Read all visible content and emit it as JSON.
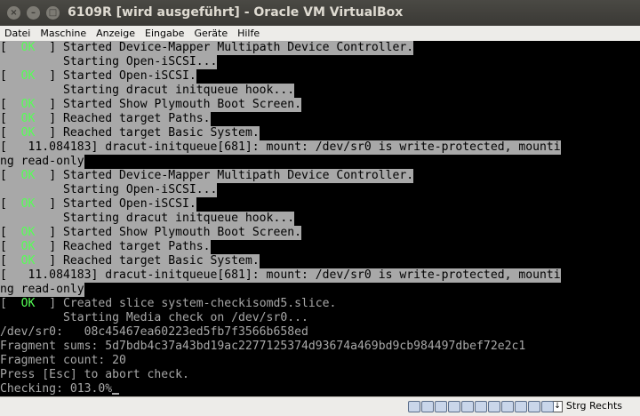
{
  "window": {
    "title": "6109R [wird ausgeführt] - Oracle VM VirtualBox",
    "close_glyph": "×",
    "min_glyph": "–",
    "max_glyph": "□"
  },
  "menu": [
    "Datei",
    "Maschine",
    "Anzeige",
    "Eingabe",
    "Geräte",
    "Hilfe"
  ],
  "console": {
    "lines": [
      {
        "ok": true,
        "text": " Started Device-Mapper Multipath Device Controller."
      },
      {
        "ok": false,
        "text": "         Starting Open-iSCSI..."
      },
      {
        "ok": true,
        "text": " Started Open-iSCSI."
      },
      {
        "ok": false,
        "text": "         Starting dracut initqueue hook..."
      },
      {
        "ok": true,
        "text": " Started Show Plymouth Boot Screen."
      },
      {
        "ok": true,
        "text": " Reached target Paths."
      },
      {
        "ok": true,
        "text": " Reached target Basic System."
      },
      {
        "ok": false,
        "text": "[   11.084183] dracut-initqueue[681]: mount: /dev/sr0 is write-protected, mounti"
      },
      {
        "ok": false,
        "text": "ng read-only"
      },
      {
        "ok": true,
        "text": " Started Device-Mapper Multipath Device Controller."
      },
      {
        "ok": false,
        "text": "         Starting Open-iSCSI..."
      },
      {
        "ok": true,
        "text": " Started Open-iSCSI."
      },
      {
        "ok": false,
        "text": "         Starting dracut initqueue hook..."
      },
      {
        "ok": true,
        "text": " Started Show Plymouth Boot Screen."
      },
      {
        "ok": true,
        "text": " Reached target Paths."
      },
      {
        "ok": true,
        "text": " Reached target Basic System."
      },
      {
        "ok": false,
        "text": "[   11.084183] dracut-initqueue[681]: mount: /dev/sr0 is write-protected, mounti"
      },
      {
        "ok": false,
        "text": "ng read-only"
      },
      {
        "ok": true,
        "text": " Created slice system-checkisomd5.slice."
      },
      {
        "ok": false,
        "text": "         Starting Media check on /dev/sr0..."
      },
      {
        "ok": false,
        "text": "/dev/sr0:   08c45467ea60223ed5fb7f3566b658ed"
      },
      {
        "ok": false,
        "text": "Fragment sums: 5d7bdb4c37a43bd19ac2277125374d93674a469bd9cb984497dbef72e2c1"
      },
      {
        "ok": false,
        "text": "Fragment count: 20"
      },
      {
        "ok": false,
        "text": "Press [Esc] to abort check."
      },
      {
        "ok": false,
        "text": "Checking: 013.0%"
      }
    ],
    "ok_label": "  OK  ",
    "ok_open": "[",
    "ok_close": "]",
    "ok_color": "#55ff55",
    "highlight_color": "#a8a8a8",
    "text_color_dark_rows": "#a8a8a8"
  },
  "statusbar": {
    "icons": [
      "hard-disk-icon",
      "optical-drive-icon",
      "audio-icon",
      "network-icon",
      "usb-icon",
      "shared-folders-icon",
      "display-icon",
      "video-capture-icon",
      "cpu-icon",
      "mouse-integration-icon",
      "keyboard-icon"
    ],
    "host_key_arrow": "↓",
    "host_key": "Strg Rechts"
  }
}
